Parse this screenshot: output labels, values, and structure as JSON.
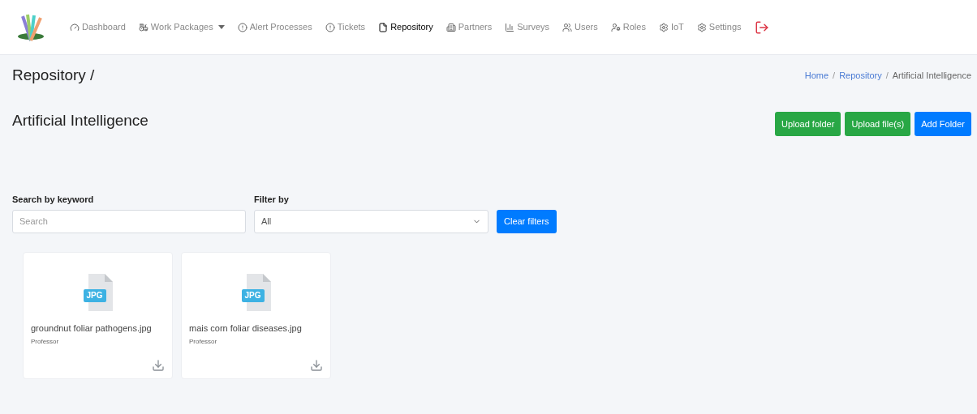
{
  "nav": [
    {
      "label": "Dashboard",
      "selected": false
    },
    {
      "label": "Work Packages",
      "selected": false,
      "dropdown": true
    },
    {
      "label": "Alert Processes",
      "selected": false
    },
    {
      "label": "Tickets",
      "selected": false
    },
    {
      "label": "Repository",
      "selected": true
    },
    {
      "label": "Partners",
      "selected": false
    },
    {
      "label": "Surveys",
      "selected": false
    },
    {
      "label": "Users",
      "selected": false
    },
    {
      "label": "Roles",
      "selected": false
    },
    {
      "label": "IoT",
      "selected": false
    },
    {
      "label": "Settings",
      "selected": false
    }
  ],
  "page_title": "Repository /",
  "breadcrumb_separator": "/",
  "breadcrumb": [
    {
      "label": "Home",
      "link": true
    },
    {
      "label": "Repository",
      "link": true
    },
    {
      "label": "Artificial Intelligence",
      "link": false
    }
  ],
  "folder_title": "Artificial Intelligence",
  "actions": [
    {
      "label": "Upload folder",
      "kind": "success"
    },
    {
      "label": "Upload file(s)",
      "kind": "success"
    },
    {
      "label": "Add Folder",
      "kind": "primary"
    }
  ],
  "search": {
    "label": "Search by keyword",
    "placeholder": "Search"
  },
  "filter": {
    "label": "Filter by",
    "value": "All"
  },
  "clear_button": "Clear filters",
  "files": [
    {
      "type_badge": "JPG",
      "name": "groundnut foliar pathogens.jpg",
      "owner": "Professor"
    },
    {
      "type_badge": "JPG",
      "name": "mais corn foliar diseases.jpg",
      "owner": "Professor"
    }
  ]
}
